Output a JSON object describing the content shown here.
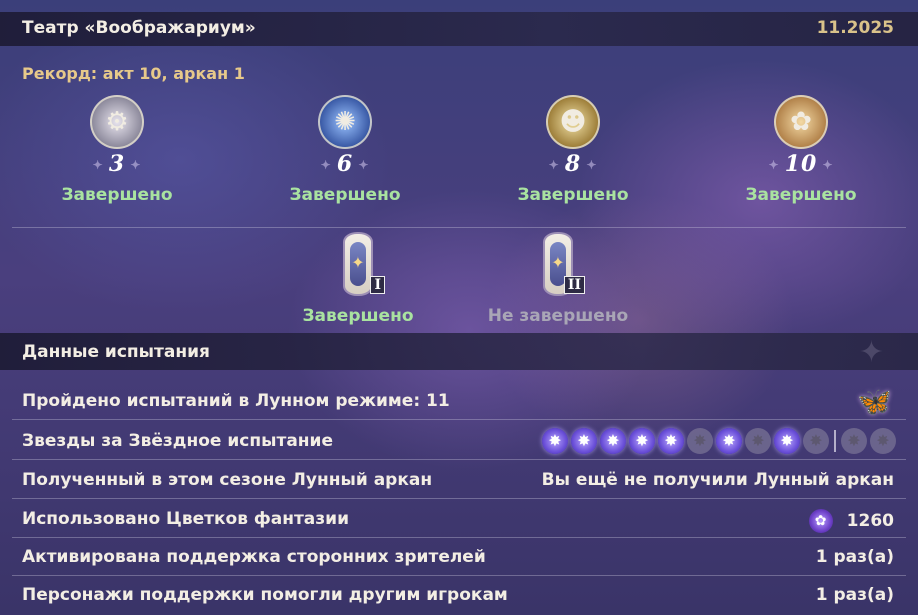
{
  "header": {
    "title": "Театр «Воображариум»",
    "date": "11.2025"
  },
  "record": "Рекорд: акт 10, аркан 1",
  "arcana": [
    {
      "number": "3",
      "status": "Завершено",
      "icon": "mechanical-figure-portrait",
      "color": "#b8b4c4"
    },
    {
      "number": "6",
      "status": "Завершено",
      "icon": "blue-flame-portrait",
      "color": "#4b6fb3"
    },
    {
      "number": "8",
      "status": "Завершено",
      "icon": "masked-creature-portrait",
      "color": "#b49a57"
    },
    {
      "number": "10",
      "status": "Завершено",
      "icon": "golden-beast-portrait",
      "color": "#b98a4e"
    }
  ],
  "cards": [
    {
      "roman": "I",
      "status": "Завершено",
      "done": true
    },
    {
      "roman": "II",
      "status": "Не завершено",
      "done": false
    }
  ],
  "section": {
    "title": "Данные испытания"
  },
  "stats": {
    "lunar_mode": {
      "label": "Пройдено испытаний в Лунном режиме: 11",
      "icon": "butterfly-icon"
    },
    "stars": {
      "label": "Звезды за Звёздное испытание",
      "states": [
        1,
        1,
        1,
        1,
        1,
        0,
        1,
        0,
        1,
        0,
        0,
        0
      ]
    },
    "lunar_arcana": {
      "label": "Полученный в этом сезоне Лунный аркан",
      "value": "Вы ещё не получили Лунный аркан"
    },
    "flowers": {
      "label": "Использовано Цветков фантазии",
      "value": "1260",
      "icon": "fantasy-flower-icon"
    },
    "support_activated": {
      "label": "Активирована поддержка сторонних зрителей",
      "value": "1 раз(а)"
    },
    "support_helped": {
      "label": "Персонажи поддержки помогли другим игрокам",
      "value": "1 раз(а)"
    }
  },
  "colors": {
    "accent_gold": "#e7c98a",
    "done_green": "#a9e3a0",
    "not_done_gray": "#a9a6b6",
    "star_on": "#6a4fd8"
  }
}
